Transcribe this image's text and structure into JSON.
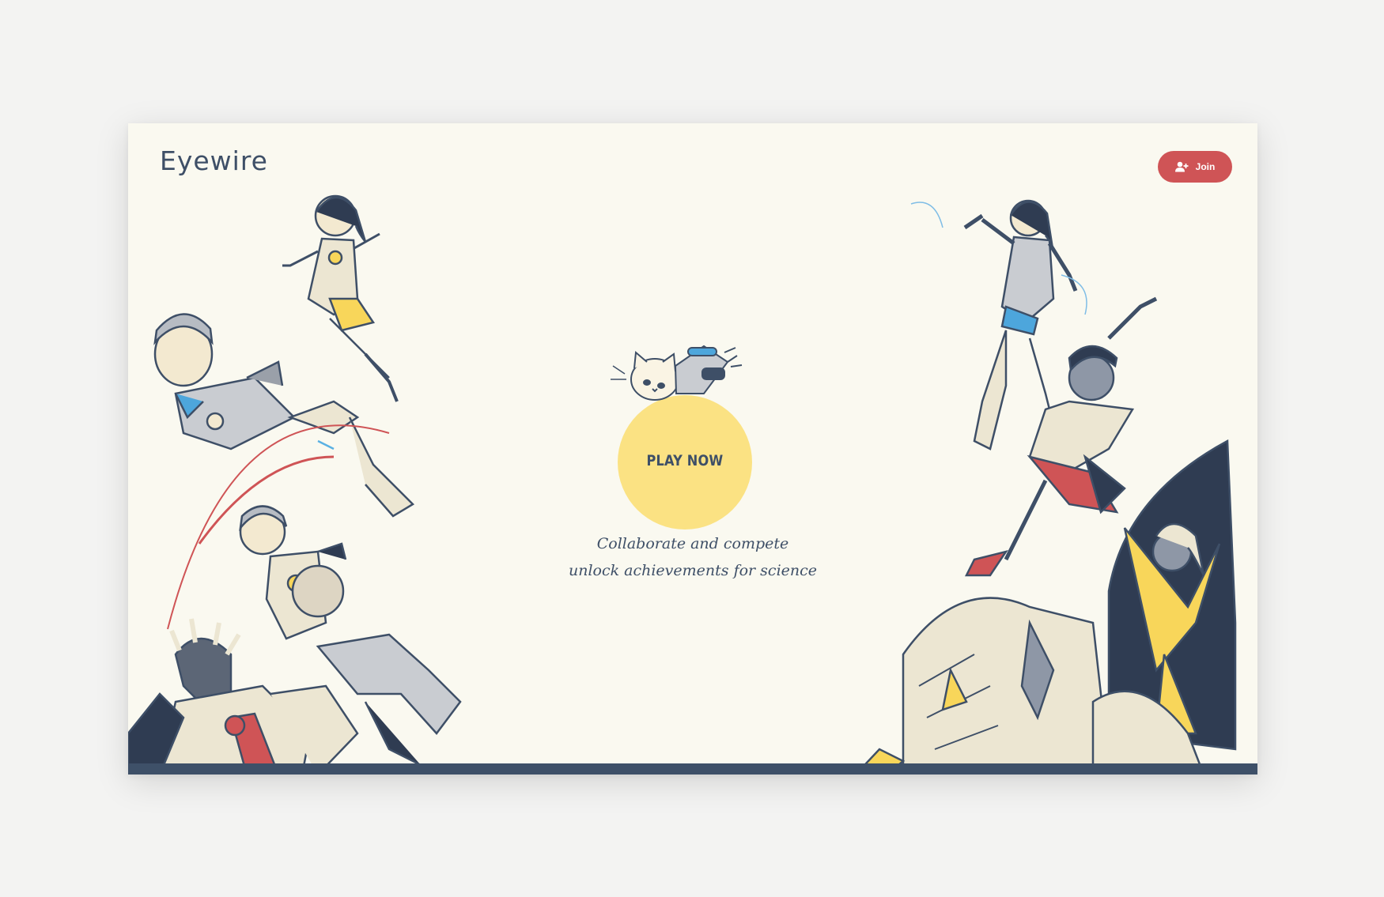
{
  "header": {
    "logo_text": "Eyewire",
    "join_label": "Join",
    "join_icon": "add-user-icon"
  },
  "main": {
    "play_label": "PLAY NOW",
    "tagline_line1": "Collaborate and compete",
    "tagline_line2": "unlock achievements for science"
  },
  "colors": {
    "background": "#faf9f0",
    "ink": "#3e4f67",
    "accent_red": "#cf5456",
    "accent_yellow": "#fbe283",
    "bottom_bar": "#3e5068"
  }
}
